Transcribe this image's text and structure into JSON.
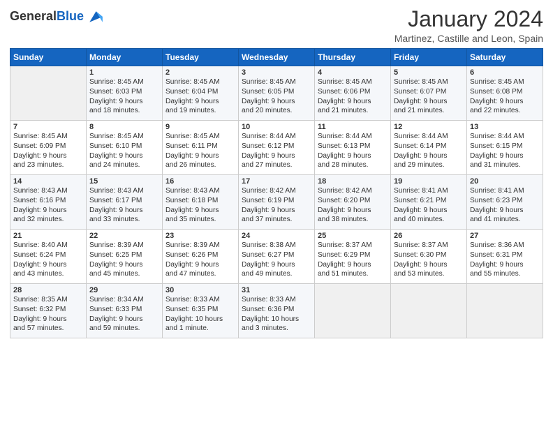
{
  "header": {
    "logo_general": "General",
    "logo_blue": "Blue",
    "month_title": "January 2024",
    "location": "Martinez, Castille and Leon, Spain"
  },
  "days_of_week": [
    "Sunday",
    "Monday",
    "Tuesday",
    "Wednesday",
    "Thursday",
    "Friday",
    "Saturday"
  ],
  "weeks": [
    [
      {
        "day": "",
        "content": ""
      },
      {
        "day": "1",
        "content": "Sunrise: 8:45 AM\nSunset: 6:03 PM\nDaylight: 9 hours\nand 18 minutes."
      },
      {
        "day": "2",
        "content": "Sunrise: 8:45 AM\nSunset: 6:04 PM\nDaylight: 9 hours\nand 19 minutes."
      },
      {
        "day": "3",
        "content": "Sunrise: 8:45 AM\nSunset: 6:05 PM\nDaylight: 9 hours\nand 20 minutes."
      },
      {
        "day": "4",
        "content": "Sunrise: 8:45 AM\nSunset: 6:06 PM\nDaylight: 9 hours\nand 21 minutes."
      },
      {
        "day": "5",
        "content": "Sunrise: 8:45 AM\nSunset: 6:07 PM\nDaylight: 9 hours\nand 21 minutes."
      },
      {
        "day": "6",
        "content": "Sunrise: 8:45 AM\nSunset: 6:08 PM\nDaylight: 9 hours\nand 22 minutes."
      }
    ],
    [
      {
        "day": "7",
        "content": "Sunrise: 8:45 AM\nSunset: 6:09 PM\nDaylight: 9 hours\nand 23 minutes."
      },
      {
        "day": "8",
        "content": "Sunrise: 8:45 AM\nSunset: 6:10 PM\nDaylight: 9 hours\nand 24 minutes."
      },
      {
        "day": "9",
        "content": "Sunrise: 8:45 AM\nSunset: 6:11 PM\nDaylight: 9 hours\nand 26 minutes."
      },
      {
        "day": "10",
        "content": "Sunrise: 8:44 AM\nSunset: 6:12 PM\nDaylight: 9 hours\nand 27 minutes."
      },
      {
        "day": "11",
        "content": "Sunrise: 8:44 AM\nSunset: 6:13 PM\nDaylight: 9 hours\nand 28 minutes."
      },
      {
        "day": "12",
        "content": "Sunrise: 8:44 AM\nSunset: 6:14 PM\nDaylight: 9 hours\nand 29 minutes."
      },
      {
        "day": "13",
        "content": "Sunrise: 8:44 AM\nSunset: 6:15 PM\nDaylight: 9 hours\nand 31 minutes."
      }
    ],
    [
      {
        "day": "14",
        "content": "Sunrise: 8:43 AM\nSunset: 6:16 PM\nDaylight: 9 hours\nand 32 minutes."
      },
      {
        "day": "15",
        "content": "Sunrise: 8:43 AM\nSunset: 6:17 PM\nDaylight: 9 hours\nand 33 minutes."
      },
      {
        "day": "16",
        "content": "Sunrise: 8:43 AM\nSunset: 6:18 PM\nDaylight: 9 hours\nand 35 minutes."
      },
      {
        "day": "17",
        "content": "Sunrise: 8:42 AM\nSunset: 6:19 PM\nDaylight: 9 hours\nand 37 minutes."
      },
      {
        "day": "18",
        "content": "Sunrise: 8:42 AM\nSunset: 6:20 PM\nDaylight: 9 hours\nand 38 minutes."
      },
      {
        "day": "19",
        "content": "Sunrise: 8:41 AM\nSunset: 6:21 PM\nDaylight: 9 hours\nand 40 minutes."
      },
      {
        "day": "20",
        "content": "Sunrise: 8:41 AM\nSunset: 6:23 PM\nDaylight: 9 hours\nand 41 minutes."
      }
    ],
    [
      {
        "day": "21",
        "content": "Sunrise: 8:40 AM\nSunset: 6:24 PM\nDaylight: 9 hours\nand 43 minutes."
      },
      {
        "day": "22",
        "content": "Sunrise: 8:39 AM\nSunset: 6:25 PM\nDaylight: 9 hours\nand 45 minutes."
      },
      {
        "day": "23",
        "content": "Sunrise: 8:39 AM\nSunset: 6:26 PM\nDaylight: 9 hours\nand 47 minutes."
      },
      {
        "day": "24",
        "content": "Sunrise: 8:38 AM\nSunset: 6:27 PM\nDaylight: 9 hours\nand 49 minutes."
      },
      {
        "day": "25",
        "content": "Sunrise: 8:37 AM\nSunset: 6:29 PM\nDaylight: 9 hours\nand 51 minutes."
      },
      {
        "day": "26",
        "content": "Sunrise: 8:37 AM\nSunset: 6:30 PM\nDaylight: 9 hours\nand 53 minutes."
      },
      {
        "day": "27",
        "content": "Sunrise: 8:36 AM\nSunset: 6:31 PM\nDaylight: 9 hours\nand 55 minutes."
      }
    ],
    [
      {
        "day": "28",
        "content": "Sunrise: 8:35 AM\nSunset: 6:32 PM\nDaylight: 9 hours\nand 57 minutes."
      },
      {
        "day": "29",
        "content": "Sunrise: 8:34 AM\nSunset: 6:33 PM\nDaylight: 9 hours\nand 59 minutes."
      },
      {
        "day": "30",
        "content": "Sunrise: 8:33 AM\nSunset: 6:35 PM\nDaylight: 10 hours\nand 1 minute."
      },
      {
        "day": "31",
        "content": "Sunrise: 8:33 AM\nSunset: 6:36 PM\nDaylight: 10 hours\nand 3 minutes."
      },
      {
        "day": "",
        "content": ""
      },
      {
        "day": "",
        "content": ""
      },
      {
        "day": "",
        "content": ""
      }
    ]
  ]
}
